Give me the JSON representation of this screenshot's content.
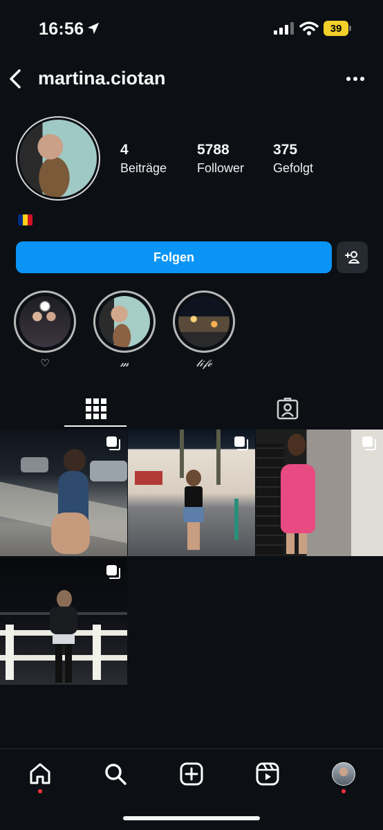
{
  "status_bar": {
    "time": "16:56",
    "battery": "39",
    "icons": [
      "location-arrow-icon",
      "signal-icon",
      "wifi-icon",
      "battery-icon"
    ]
  },
  "header": {
    "username": "martina.ciotan",
    "back_icon": "chevron-left-icon",
    "more_icon": "ellipsis-icon"
  },
  "profile": {
    "stats": [
      {
        "value": "4",
        "label": "Beiträge"
      },
      {
        "value": "5788",
        "label": "Follower"
      },
      {
        "value": "375",
        "label": "Gefolgt"
      }
    ],
    "bio_flag": "romania-flag",
    "flag_colors": [
      "#002b7f",
      "#fcd116",
      "#ce1126"
    ]
  },
  "actions": {
    "follow_label": "Folgen",
    "add_user_icon": "add-person-icon",
    "accent": "#0a95f6"
  },
  "highlights": [
    {
      "label": "♡"
    },
    {
      "label": "𝓂"
    },
    {
      "label": "𝓁𝒾𝒻ℯ"
    }
  ],
  "tabs": [
    {
      "name": "grid",
      "icon": "grid-icon",
      "active": true
    },
    {
      "name": "tagged",
      "icon": "tagged-person-icon",
      "active": false
    }
  ],
  "posts": [
    {
      "icon": "multiple-images-icon"
    },
    {
      "icon": "multiple-images-icon"
    },
    {
      "icon": "multiple-images-icon"
    },
    {
      "icon": "multiple-images-icon"
    }
  ],
  "bottom_nav": [
    "home-icon",
    "search-icon",
    "create-icon",
    "reels-icon",
    "profile-avatar"
  ],
  "notification_color": "#ff3040"
}
